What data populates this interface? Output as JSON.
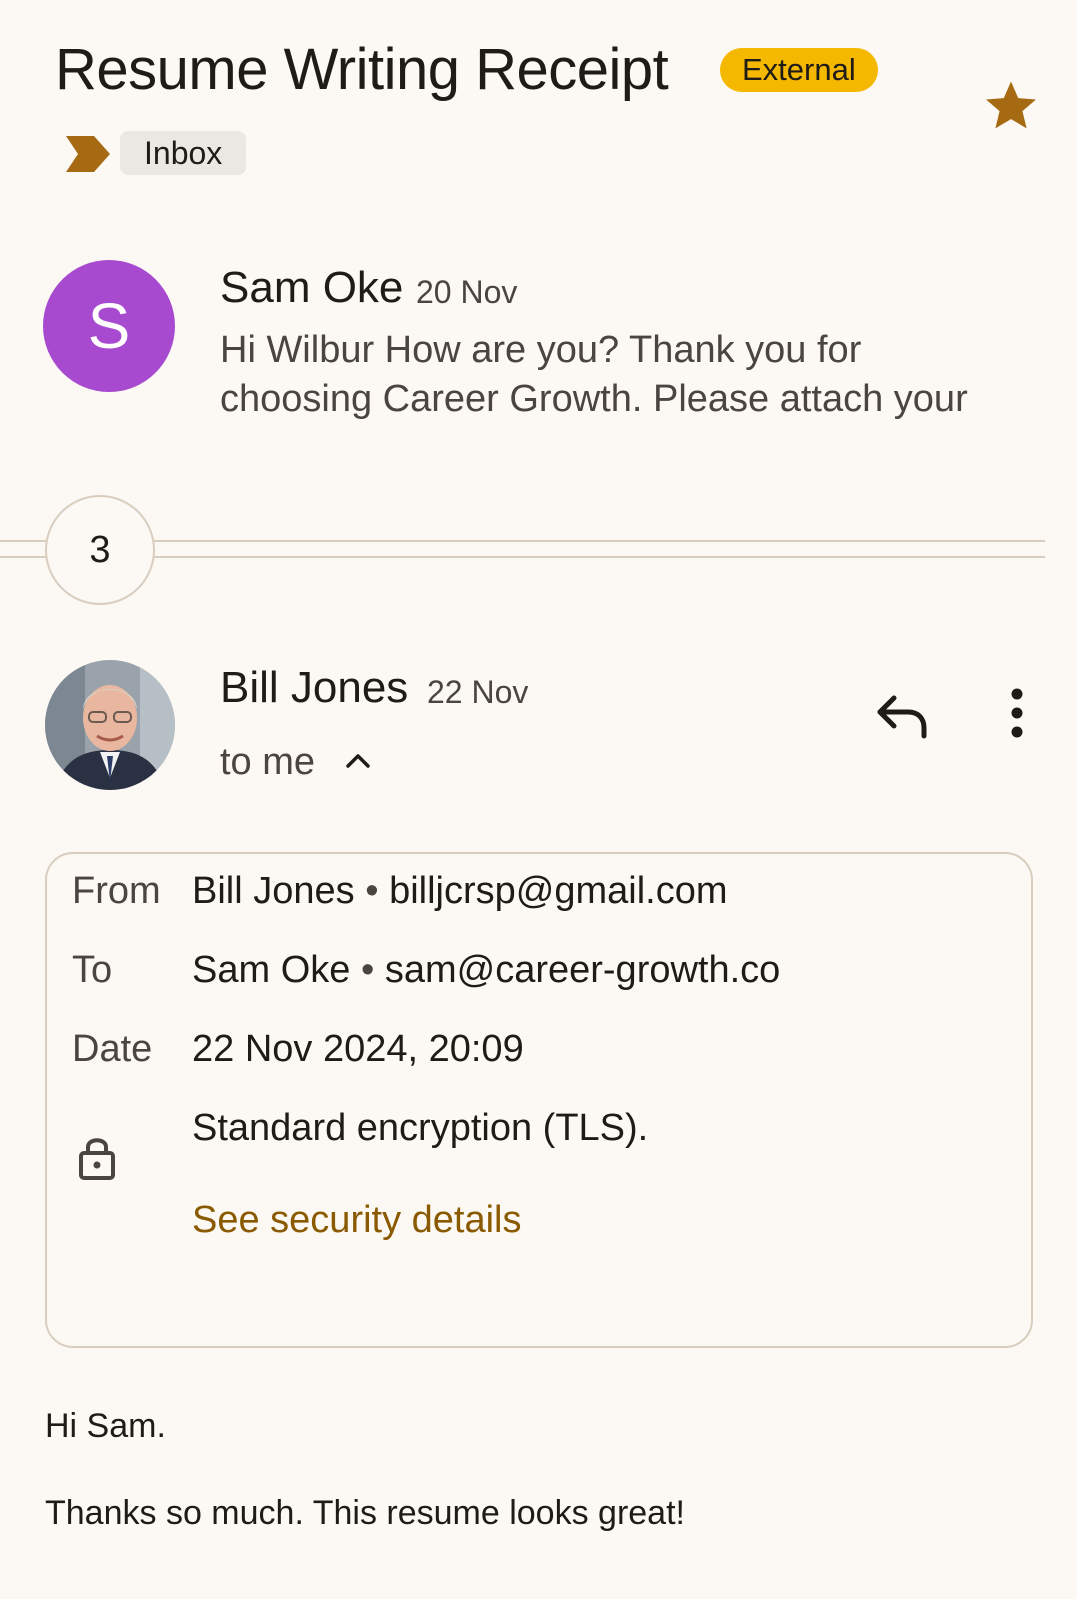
{
  "thread": {
    "subject": "Resume Writing Receipt",
    "external_badge": "External",
    "label": "Inbox"
  },
  "messages": [
    {
      "sender": "Sam Oke",
      "avatar_letter": "S",
      "avatar_color": "#a84ad0",
      "date": "20 Nov",
      "snippet": "Hi Wilbur How are you? Thank you for choosing Career Growth. Please attach your"
    },
    {
      "sender": "Bill Jones",
      "date": "22 Nov",
      "recipient_summary": "to me"
    }
  ],
  "collapsed": {
    "count": "3"
  },
  "details": {
    "from_label": "From",
    "from_name": "Bill Jones",
    "from_email": "billjcrsp@gmail.com",
    "to_label": "To",
    "to_name": "Sam Oke",
    "to_email": "sam@career-growth.co",
    "date_label": "Date",
    "date_value": "22 Nov 2024, 20:09",
    "encryption": "Standard encryption (TLS).",
    "security_link": "See security details",
    "separator": "•"
  },
  "body": {
    "greeting": "Hi Sam.",
    "line1": "Thanks so much.  This resume looks great!"
  },
  "icons": {
    "star": "star-icon",
    "label_marker": "important-marker-icon",
    "reply": "reply-icon",
    "more": "more-vert-icon",
    "expand": "chevron-up-icon",
    "lock": "lock-icon"
  },
  "colors": {
    "background": "#fcf8f4",
    "accent": "#a66b12",
    "external_badge": "#f5b800",
    "link": "#8a5a00"
  }
}
